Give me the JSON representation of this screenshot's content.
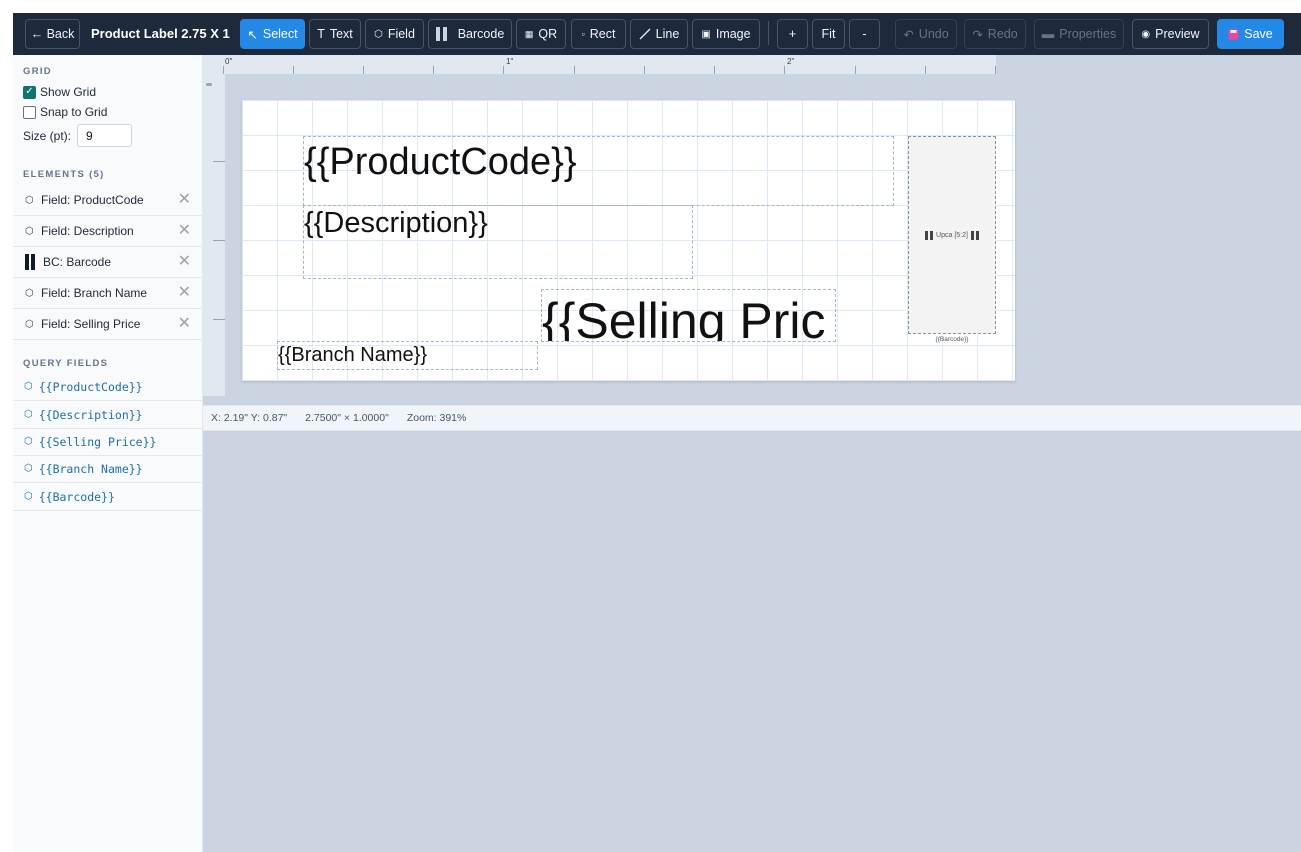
{
  "toolbar": {
    "back_label": "← Back",
    "title": "Product Label 2.75 X 1",
    "select_label": "Select",
    "text_label": "Text",
    "field_label": "Field",
    "barcode_label": "Barcode",
    "qr_label": "QR",
    "rect_label": "Rect",
    "line_label": "Line",
    "image_label": "Image",
    "zoom_in_label": "+",
    "fit_label": "Fit",
    "zoom_out_label": "-",
    "undo_label": "Undo",
    "redo_label": "Redo",
    "properties_label": "Properties",
    "preview_label": "Preview",
    "save_label": "Save"
  },
  "sidebar": {
    "grid_heading": "GRID",
    "show_grid_label": "Show Grid",
    "show_grid_checked": true,
    "snap_label": "Snap to Grid",
    "snap_checked": false,
    "size_label": "Size (pt):",
    "size_value": "9",
    "elements_heading": "ELEMENTS (5)",
    "elements": [
      {
        "icon": "field-icon",
        "label": "Field: ProductCode"
      },
      {
        "icon": "field-icon",
        "label": "Field: Description"
      },
      {
        "icon": "barcode-icon",
        "label": "BC: Barcode"
      },
      {
        "icon": "field-icon",
        "label": "Field: Branch Name"
      },
      {
        "icon": "field-icon",
        "label": "Field: Selling Price"
      }
    ],
    "query_heading": "QUERY FIELDS",
    "query_fields": [
      "{{ProductCode}}",
      "{{Description}}",
      "{{Selling Price}}",
      "{{Branch Name}}",
      "{{Barcode}}"
    ]
  },
  "ruler": {
    "labels": [
      "0\"",
      "1\"",
      "2\""
    ]
  },
  "canvas": {
    "fields": {
      "product_code": "{{ProductCode}}",
      "description": "{{Description}}",
      "selling_price": "{{Selling Pric",
      "branch_name": "{{Branch Name}}"
    },
    "barcode_text": "Upca [5:2]",
    "barcode_caption": "{{Barcode}}"
  },
  "status": {
    "coords": "X: 2.19\"  Y: 0.87\"",
    "dimensions": "2.7500\" × 1.0000\"",
    "zoom": "Zoom: 391%"
  },
  "colors": {
    "toolbar_bg": "#1e293b",
    "accent": "#2388e6",
    "workspace_bg": "#cbd5e1",
    "query_field_text": "#1d6fa5"
  }
}
